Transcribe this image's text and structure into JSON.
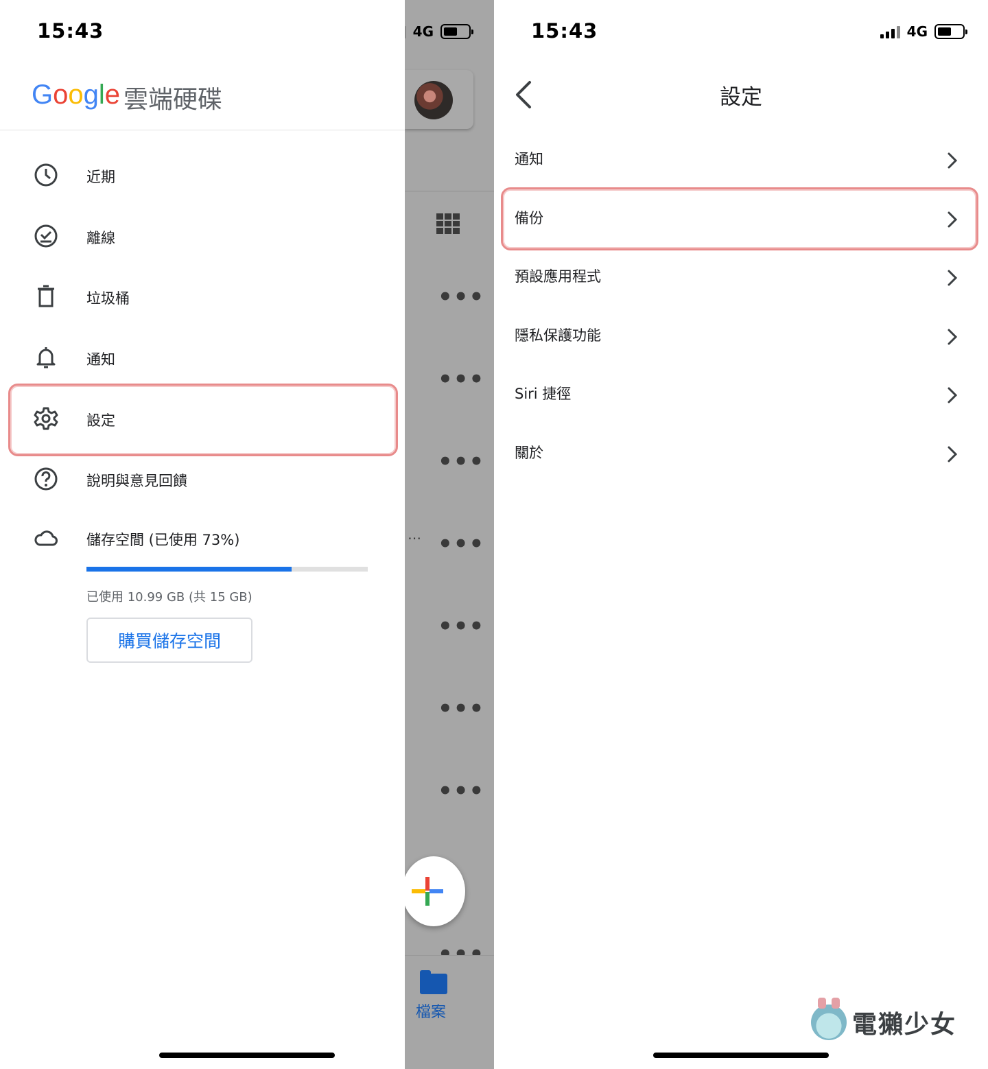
{
  "left": {
    "status": {
      "time": "15:43",
      "network": "4G"
    },
    "app": {
      "logo": "Google",
      "name": "雲端硬碟"
    },
    "menu": [
      {
        "label": "近期",
        "icon": "clock-icon"
      },
      {
        "label": "離線",
        "icon": "offline-check-icon"
      },
      {
        "label": "垃圾桶",
        "icon": "trash-icon"
      },
      {
        "label": "通知",
        "icon": "bell-icon"
      },
      {
        "label": "設定",
        "icon": "gear-icon"
      },
      {
        "label": "說明與意見回饋",
        "icon": "help-icon"
      },
      {
        "label": "儲存空間 (已使用 73%)",
        "icon": "cloud-icon"
      }
    ],
    "storage": {
      "used_percent": 73,
      "detail": "已使用 10.99 GB (共 15 GB)",
      "buy_label": "購買儲存空間"
    },
    "background": {
      "files_tab": "檔案"
    }
  },
  "right": {
    "status": {
      "time": "15:43",
      "network": "4G"
    },
    "title": "設定",
    "items": [
      "通知",
      "備份",
      "預設應用程式",
      "隱私保護功能",
      "Siri 捷徑",
      "關於"
    ],
    "watermark": "電獺少女"
  },
  "colors": {
    "accent": "#1a73e8",
    "highlight": "#e88b8b",
    "overlay": "#a6a6a6"
  }
}
